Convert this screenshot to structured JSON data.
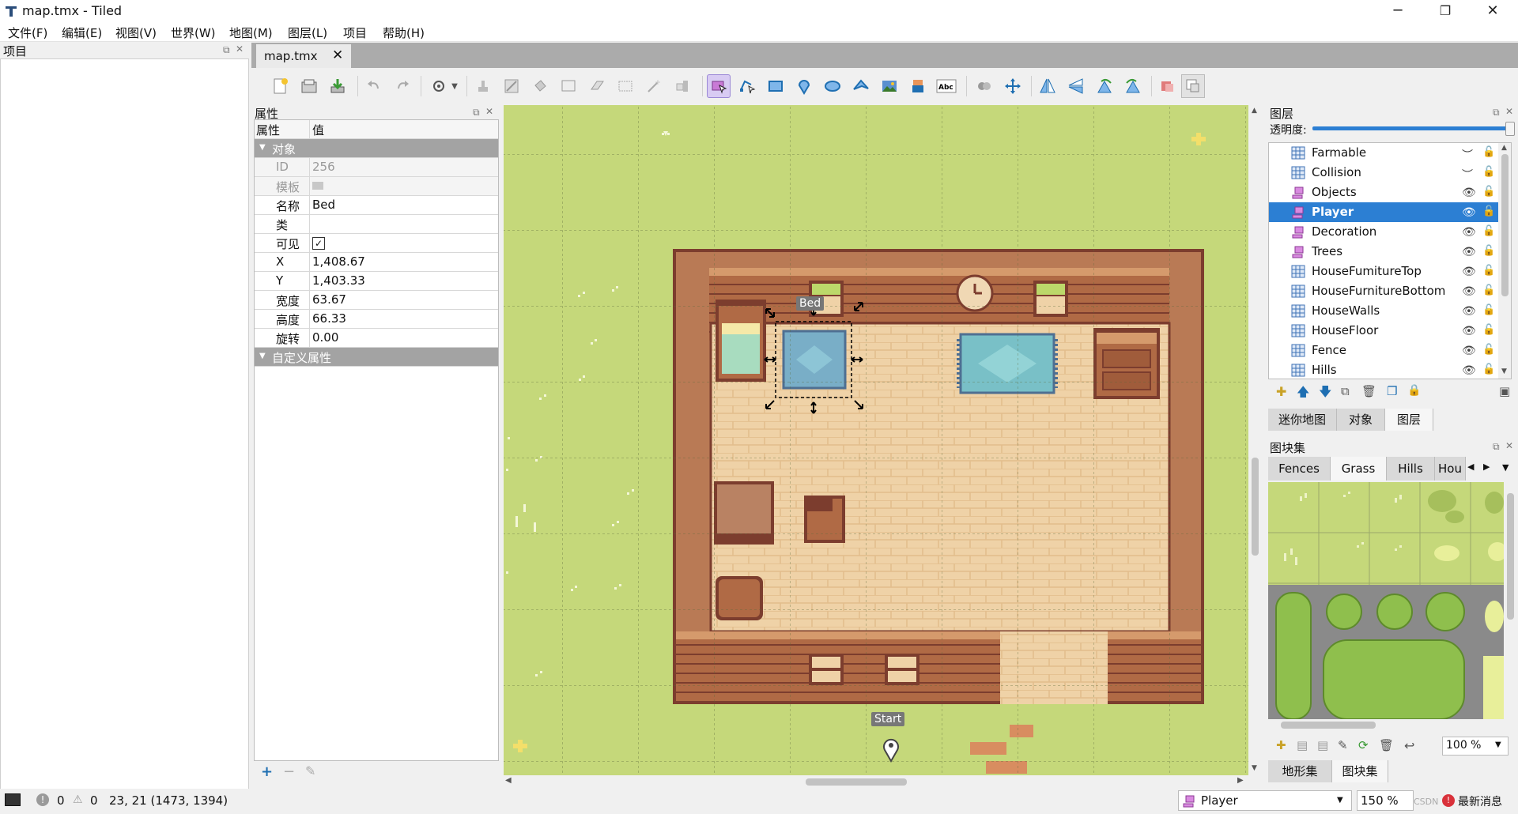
{
  "window": {
    "title": "map.tmx - Tiled",
    "minimize": "─",
    "maximize": "❐",
    "close": "✕"
  },
  "menu": [
    "文件(F)",
    "编辑(E)",
    "视图(V)",
    "世界(W)",
    "地图(M)",
    "图层(L)",
    "项目",
    "帮助(H)"
  ],
  "project_panel": {
    "title": "项目"
  },
  "document_tab": {
    "label": "map.tmx",
    "close": "✕"
  },
  "properties": {
    "title": "属性",
    "header": {
      "key": "属性",
      "value": "值"
    },
    "group_object": "对象",
    "rows": [
      {
        "key": "ID",
        "value": "256",
        "readonly": true
      },
      {
        "key": "模板",
        "value": "",
        "readonly": true
      },
      {
        "key": "名称",
        "value": "Bed"
      },
      {
        "key": "类",
        "value": ""
      },
      {
        "key": "可见",
        "value": "✓"
      },
      {
        "key": "X",
        "value": "1,408.67"
      },
      {
        "key": "Y",
        "value": "1,403.33"
      },
      {
        "key": "宽度",
        "value": "63.67"
      },
      {
        "key": "高度",
        "value": "66.33"
      },
      {
        "key": "旋转",
        "value": "0.00"
      }
    ],
    "group_custom": "自定义属性",
    "footer": {
      "add": "+",
      "remove": "−",
      "rename": "✎"
    }
  },
  "map": {
    "selected_object_label": "Bed",
    "start_label": "Start"
  },
  "layers": {
    "title": "图层",
    "opacity_label": "透明度:",
    "opacity": 1.0,
    "items": [
      {
        "name": "Farmable",
        "type": "tile",
        "visible": false
      },
      {
        "name": "Collision",
        "type": "tile",
        "visible": false
      },
      {
        "name": "Objects",
        "type": "object",
        "visible": true
      },
      {
        "name": "Player",
        "type": "object",
        "visible": true,
        "selected": true
      },
      {
        "name": "Decoration",
        "type": "object",
        "visible": true
      },
      {
        "name": "Trees",
        "type": "object",
        "visible": true
      },
      {
        "name": "HouseFumitureTop",
        "type": "tile",
        "visible": true
      },
      {
        "name": "HouseFurnitureBottom",
        "type": "tile",
        "visible": true
      },
      {
        "name": "HouseWalls",
        "type": "tile",
        "visible": true
      },
      {
        "name": "HouseFloor",
        "type": "tile",
        "visible": true
      },
      {
        "name": "Fence",
        "type": "tile",
        "visible": true
      },
      {
        "name": "Hills",
        "type": "tile",
        "visible": true
      }
    ],
    "bottom_tabs": [
      "迷你地图",
      "对象",
      "图层"
    ]
  },
  "tilesets": {
    "title": "图块集",
    "tabs": [
      "Fences",
      "Grass",
      "Hills",
      "Hou"
    ],
    "zoom": "100 %",
    "bottom_tabs": [
      "地形集",
      "图块集"
    ]
  },
  "status": {
    "errors": "0",
    "warnings": "0",
    "coords": "23, 21 (1473, 1394)",
    "layer": "Player",
    "zoom": "150 %",
    "news": "最新消息",
    "watermark": "CSDN"
  },
  "colors": {
    "selection": "#2c7fd3",
    "grass": "#c5d87a",
    "wood": "#a86b46",
    "floor": "#efd2a7"
  }
}
